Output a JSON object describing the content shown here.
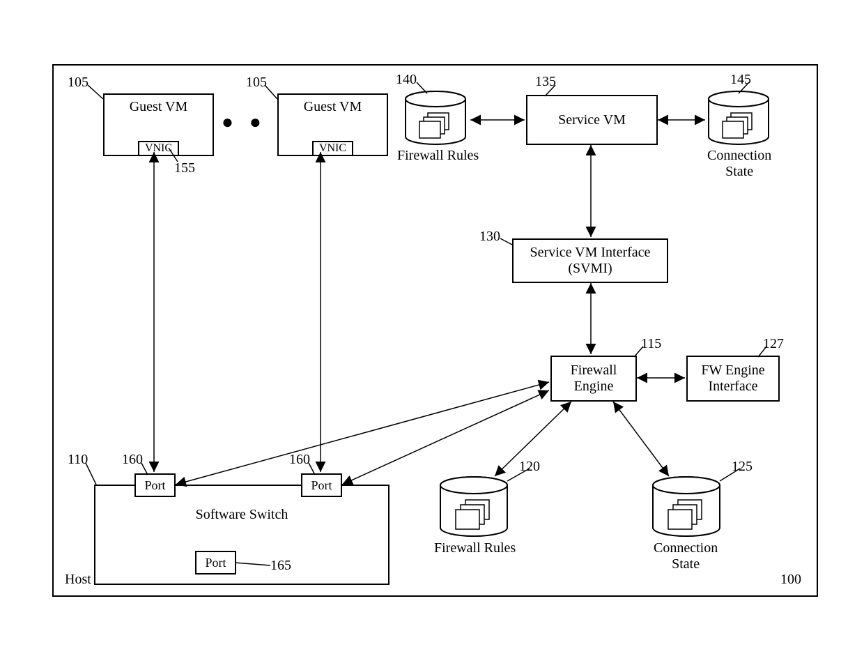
{
  "host": {
    "label": "Host",
    "ref": "100"
  },
  "guestVM1": {
    "label": "Guest VM",
    "vnic": "VNIC",
    "ref": "105",
    "vnicRef": "155"
  },
  "guestVM2": {
    "label": "Guest VM",
    "vnic": "VNIC",
    "ref": "105"
  },
  "serviceVM": {
    "label": "Service VM",
    "ref": "135"
  },
  "firewallRulesTop": {
    "label": "Firewall Rules",
    "ref": "140"
  },
  "connectionStateTop": {
    "label": "Connection\nState",
    "ref": "145"
  },
  "svmi": {
    "label": "Service VM Interface\n(SVMI)",
    "ref": "130"
  },
  "firewallEngine": {
    "label": "Firewall\nEngine",
    "ref": "115"
  },
  "fwEngineInterface": {
    "label": "FW Engine\nInterface",
    "ref": "127"
  },
  "firewallRulesBottom": {
    "label": "Firewall Rules",
    "ref": "120"
  },
  "connectionStateBottom": {
    "label": "Connection\nState",
    "ref": "125"
  },
  "softwareSwitch": {
    "label": "Software Switch",
    "ref": "110"
  },
  "port1": {
    "label": "Port",
    "ref": "160"
  },
  "port2": {
    "label": "Port",
    "ref": "160"
  },
  "port3": {
    "label": "Port",
    "ref": "165"
  }
}
